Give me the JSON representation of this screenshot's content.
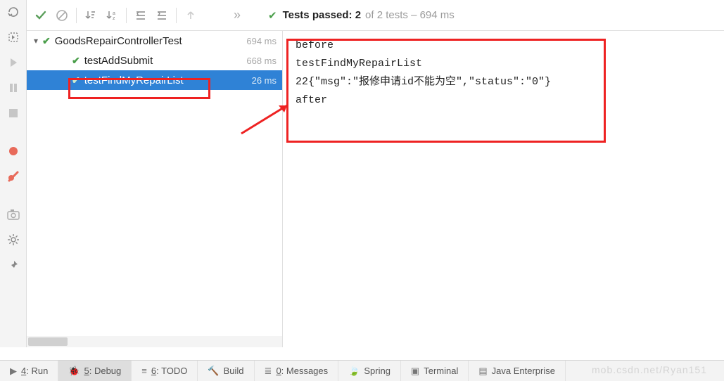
{
  "toolbar": {
    "status_prefix": "Tests passed: ",
    "status_count": "2",
    "status_suffix": "of 2 tests – 694 ms"
  },
  "tree": {
    "root": {
      "label": "GoodsRepairControllerTest",
      "time": "694 ms"
    },
    "items": [
      {
        "label": "testAddSubmit",
        "time": "668 ms"
      },
      {
        "label": "testFindMyRepairList",
        "time": "26 ms"
      }
    ]
  },
  "console": {
    "lines": [
      "before",
      "testFindMyRepairList",
      "22{\"msg\":\"报修申请id不能为空\",\"status\":\"0\"}",
      "after"
    ]
  },
  "bottombar": {
    "run": "4: Run",
    "debug": "5: Debug",
    "todo": "6: TODO",
    "build": "Build",
    "messages": "0: Messages",
    "spring": "Spring",
    "terminal": "Terminal",
    "javaee": "Java Enterprise"
  },
  "watermark": "mob.csdn.net/Ryan151"
}
